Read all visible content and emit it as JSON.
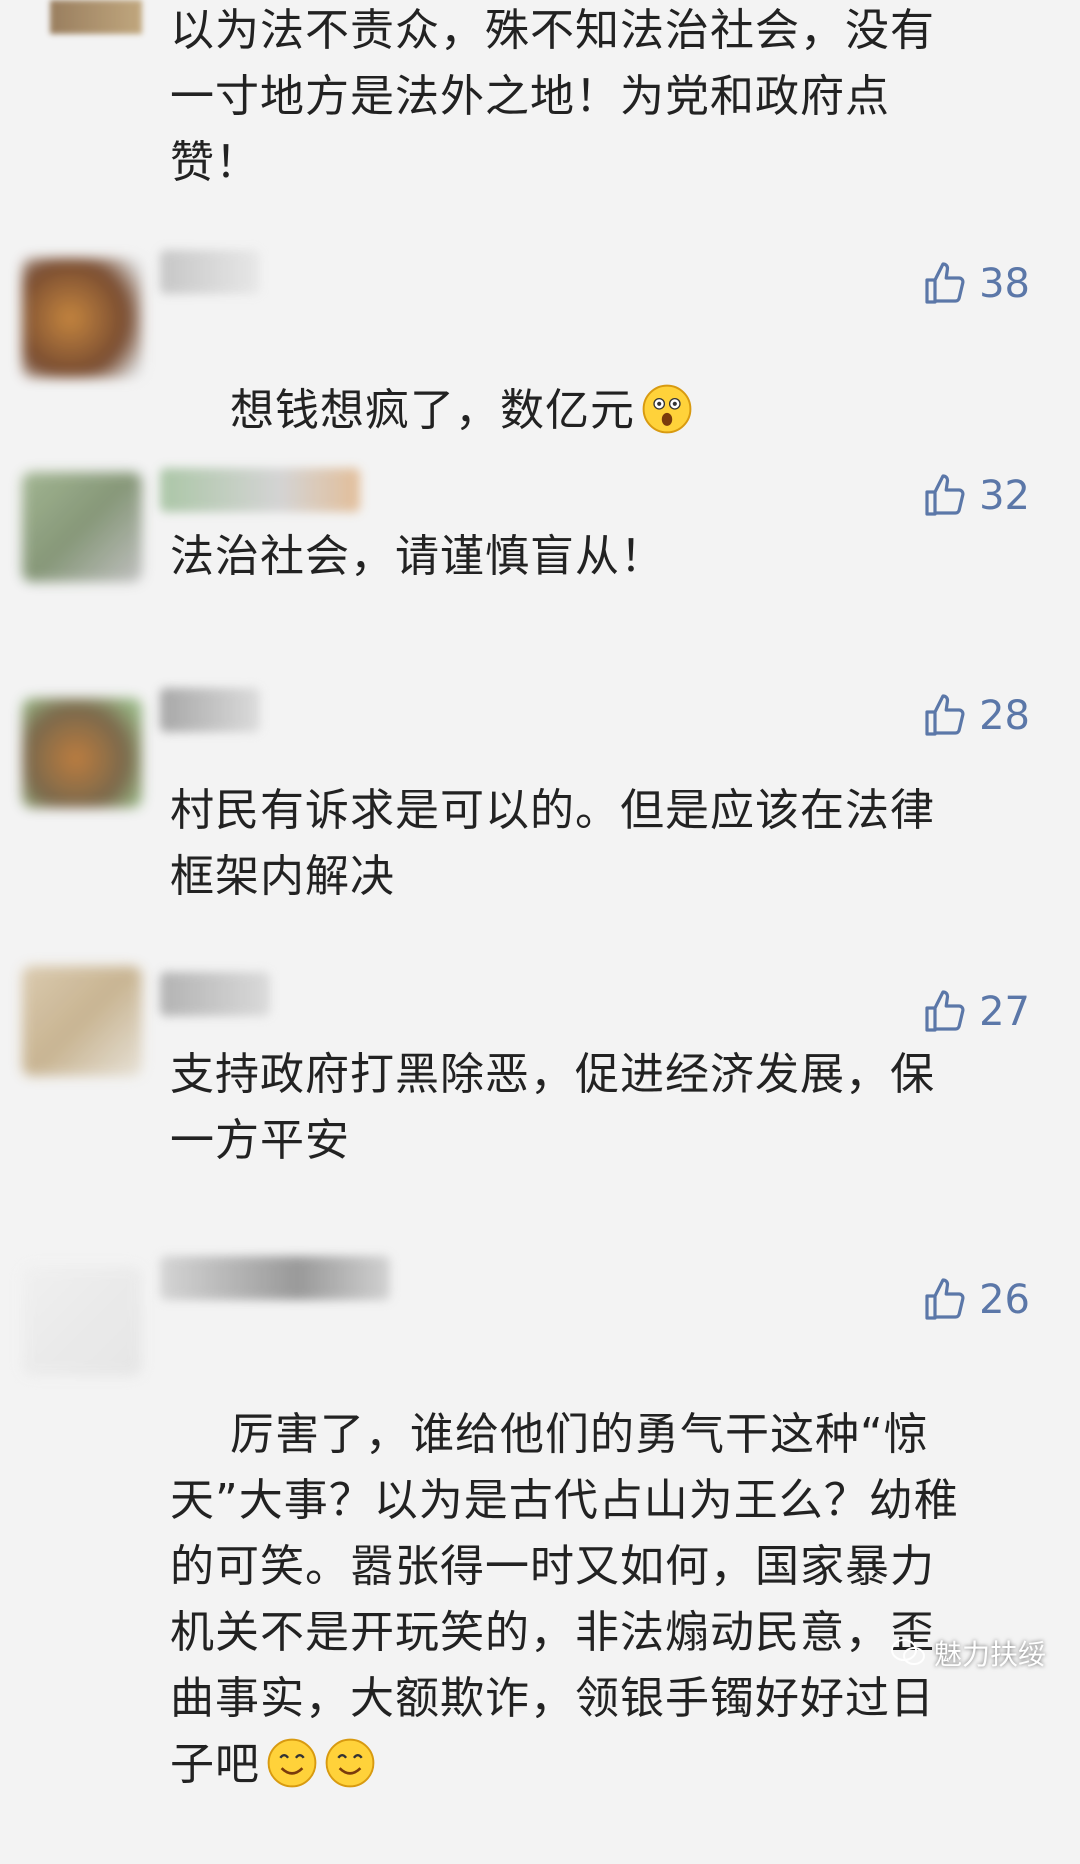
{
  "comments": [
    {
      "text": "以为法不责众，殊不知法治社会，没有\n一寸地方是法外之地！为党和政府点\n赞！"
    },
    {
      "likes": "38",
      "text": "想钱想疯了，数亿元"
    },
    {
      "likes": "32",
      "text": "法治社会，请谨慎盲从！"
    },
    {
      "likes": "28",
      "text": "村民有诉求是可以的。但是应该在法律\n框架内解决"
    },
    {
      "likes": "27",
      "text": "支持政府打黑除恶，促进经济发展，保\n一方平安"
    },
    {
      "likes": "26",
      "text": "厉害了，谁给他们的勇气干这种“惊\n天”大事？以为是古代占山为王么？幼稚\n的可笑。嚣张得一时又如何，国家暴力\n机关不是开玩笑的，非法煽动民意，歪\n曲事实，大额欺诈，领银手镯好好过日\n子吧"
    }
  ],
  "icons": {
    "like": "thumbs-up-icon",
    "emoji": "smile-emoji-icon"
  },
  "watermark": {
    "text": "魅力扶绥"
  },
  "colors": {
    "background": "#f3f3f3",
    "like_blue": "#5b77a8",
    "text": "#222222"
  }
}
